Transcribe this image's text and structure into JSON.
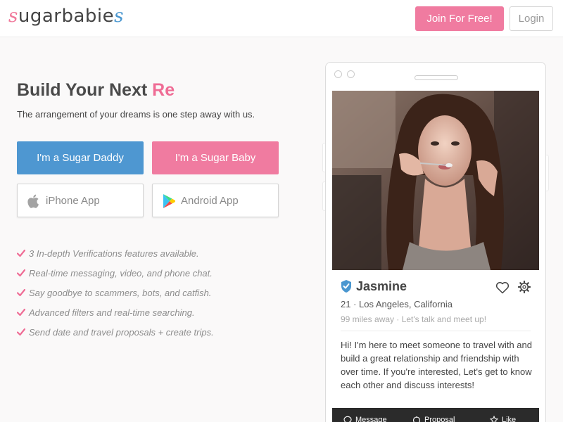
{
  "header": {
    "logo": {
      "s_left": "s",
      "mid": "ugarbabie",
      "s_right": "s"
    },
    "join_label": "Join For Free!",
    "login_label": "Login"
  },
  "hero": {
    "headline_main": "Build Your Next ",
    "headline_accent": "Re",
    "subtitle": "The arrangement of your dreams is one step away with us.",
    "daddy_label": "I'm a Sugar Daddy",
    "baby_label": "I'm a Sugar Baby",
    "iphone_label": "iPhone App",
    "android_label": "Android App"
  },
  "features": [
    "3 In-depth Verifications features available.",
    "Real-time messaging, video, and phone chat.",
    "Say goodbye to scammers, bots, and catfish.",
    "Advanced filters and real-time searching.",
    "Send date and travel proposals + create trips."
  ],
  "profile": {
    "name": "Jasmine",
    "meta": "21 · Los Angeles, California",
    "distance": "99 miles away · Let's talk and meet up!",
    "bio": "Hi! I'm here to meet someone to travel with and build a great relationship and friendship with over time. If you're interested, Let's get to know each other and discuss interests!",
    "actions": [
      "Message",
      "Proposal",
      "Like"
    ]
  },
  "colors": {
    "pink": "#f07ba0",
    "blue": "#4e97d1",
    "check": "#ef6c95",
    "verified": "#4a97d0"
  },
  "icons": [
    "apple-icon",
    "google-play-icon",
    "check-icon",
    "verified-badge-icon",
    "heart-icon",
    "gear-icon",
    "message-icon",
    "proposal-icon",
    "star-icon"
  ]
}
